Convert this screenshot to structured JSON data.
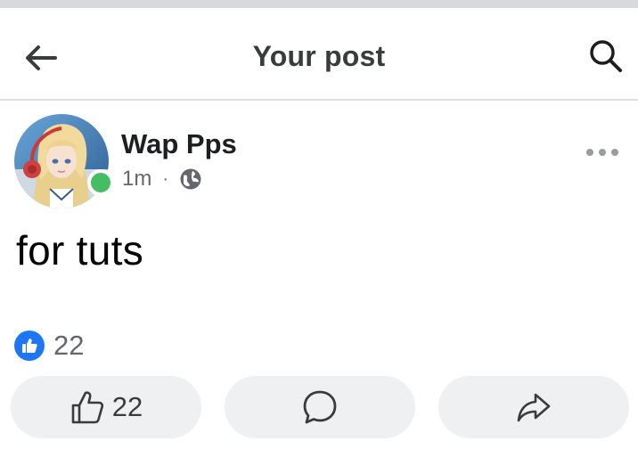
{
  "header": {
    "title": "Your post",
    "back_icon": "arrow-left-icon",
    "search_icon": "search-icon"
  },
  "post": {
    "author": "Wap Pps",
    "time": "1m",
    "separator": "·",
    "audience_icon": "globe-icon",
    "text": "for tuts",
    "online": true,
    "online_color": "#45bd62"
  },
  "reactions": {
    "icon": "like-icon",
    "count": "22",
    "color": "#1d77f2"
  },
  "actions": {
    "like_icon": "thumbs-up-icon",
    "like_count": "22",
    "comment_icon": "comment-icon",
    "share_icon": "share-icon"
  }
}
